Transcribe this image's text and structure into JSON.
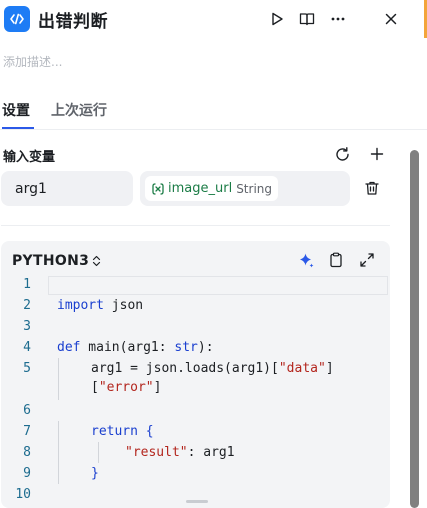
{
  "header": {
    "title": "出错判断",
    "icons": {
      "app": "code-icon",
      "run": "play-icon",
      "docs": "book-icon",
      "more": "more-icon",
      "close": "close-icon"
    }
  },
  "description_placeholder": "添加描述...",
  "tabs": [
    {
      "label": "设置",
      "active": true
    },
    {
      "label": "上次运行",
      "active": false
    }
  ],
  "inputs_section": {
    "title": "输入变量",
    "rows": [
      {
        "name": "arg1",
        "value_var": "image_url",
        "value_type": "String"
      }
    ]
  },
  "code_panel": {
    "language": "PYTHON3",
    "line_numbers": [
      "1",
      "2",
      "3",
      "4",
      "5",
      "6",
      "7",
      "8",
      "9",
      "10"
    ]
  },
  "colors": {
    "accent": "#2b59e8",
    "keyword": "#1a3fcf",
    "string": "#b3261e",
    "line_number": "#1d6c8f",
    "variable_chip": "#1b7c46"
  }
}
